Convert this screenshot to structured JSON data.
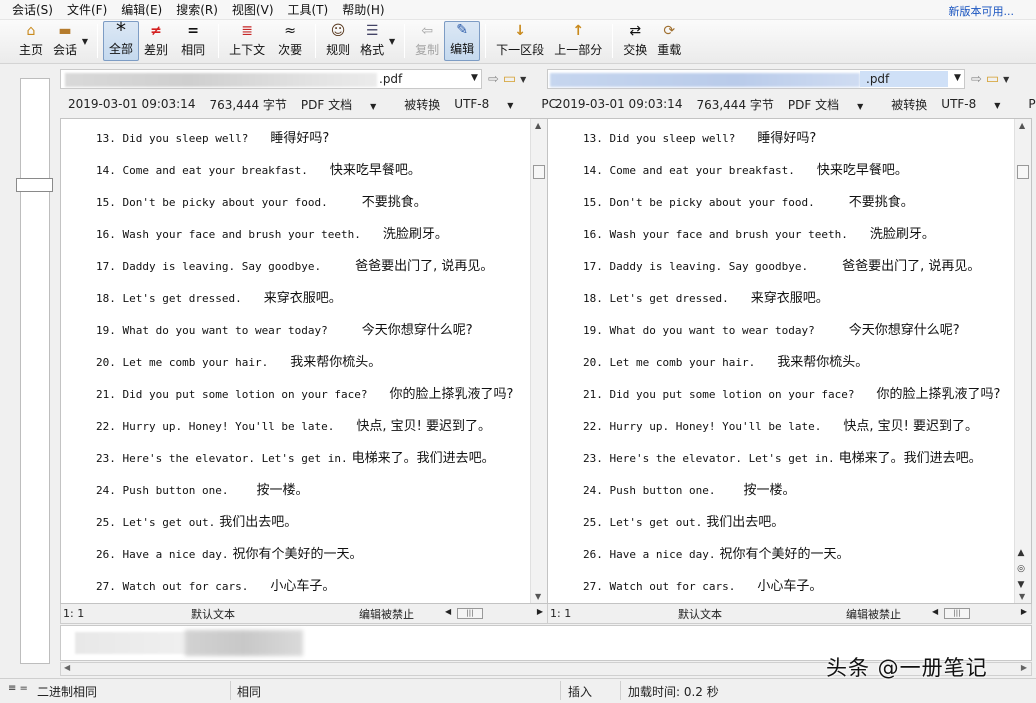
{
  "menu": [
    "会话(S)",
    "文件(F)",
    "编辑(E)",
    "搜索(R)",
    "视图(V)",
    "工具(T)",
    "帮助(H)"
  ],
  "promo": "新版本可用...",
  "toolbar": [
    {
      "label": "主页",
      "icon": "home-icon",
      "glyph": "⌂"
    },
    {
      "label": "会话",
      "icon": "briefcase-icon",
      "glyph": "▬"
    },
    {
      "label": "全部",
      "icon": "asterisk-icon",
      "glyph": "*"
    },
    {
      "label": "差别",
      "icon": "not-equal-icon",
      "glyph": "≠"
    },
    {
      "label": "相同",
      "icon": "equal-icon",
      "glyph": "="
    },
    {
      "label": "上下文",
      "icon": "context-icon",
      "glyph": "≣"
    },
    {
      "label": "次要",
      "icon": "approx-icon",
      "glyph": "≈"
    },
    {
      "label": "规则",
      "icon": "person-icon",
      "glyph": "☺"
    },
    {
      "label": "格式",
      "icon": "format-icon",
      "glyph": "☰"
    },
    {
      "label": "复制",
      "icon": "copy-arrow-icon",
      "glyph": "⇦"
    },
    {
      "label": "编辑",
      "icon": "pencil-icon",
      "glyph": "✎"
    },
    {
      "label": "下一区段",
      "icon": "arrow-down-icon",
      "glyph": "↓"
    },
    {
      "label": "上一部分",
      "icon": "arrow-up-icon",
      "glyph": "↑"
    },
    {
      "label": "交换",
      "icon": "swap-icon",
      "glyph": "⇄"
    },
    {
      "label": "重载",
      "icon": "reload-icon",
      "glyph": "⟳"
    }
  ],
  "left": {
    "path_suffix": ".pdf",
    "date": "2019-03-01 09:03:14",
    "size": "763,444 字节",
    "format": "PDF 文档",
    "state": "被转换",
    "encoding": "UTF-8",
    "lineend": "PC",
    "pos": "1: 1",
    "syntax": "默认文本",
    "editstate": "编辑被禁止"
  },
  "right": {
    "path_suffix": ".pdf",
    "date": "2019-03-01 09:03:14",
    "size": "763,444 字节",
    "format": "PDF 文档",
    "state": "被转换",
    "encoding": "UTF-8",
    "lineend": "PC",
    "pos": "1: 1",
    "syntax": "默认文本",
    "editstate": "编辑被禁止"
  },
  "lines": [
    {
      "en": "13. Did you sleep well?",
      "zh": "睡得好吗?",
      "gap": 3
    },
    {
      "en": "14. Come and eat your breakfast.",
      "zh": "快来吃早餐吧。",
      "gap": 3
    },
    {
      "en": "15. Don't be picky about your food.",
      "zh": "不要挑食。",
      "gap": 5
    },
    {
      "en": "16. Wash your face and brush your teeth.",
      "zh": "洗脸刷牙。",
      "gap": 3
    },
    {
      "en": "17. Daddy is leaving. Say goodbye.",
      "zh": "爸爸要出门了, 说再见。",
      "gap": 5
    },
    {
      "en": "18. Let's get dressed.",
      "zh": "来穿衣服吧。",
      "gap": 3
    },
    {
      "en": "19. What do you want to wear today?",
      "zh": "今天你想穿什么呢?",
      "gap": 5
    },
    {
      "en": "20. Let me comb your hair.",
      "zh": "我来帮你梳头。",
      "gap": 3
    },
    {
      "en": "21. Did you put some lotion on your face?",
      "zh": "你的脸上搽乳液了吗?",
      "gap": 3
    },
    {
      "en": "22. Hurry up. Honey! You'll be late.",
      "zh": "快点, 宝贝! 要迟到了。",
      "gap": 3
    },
    {
      "en": "23. Here's the elevator. Let's get in.",
      "zh": "电梯来了。我们进去吧。",
      "gap": 0
    },
    {
      "en": "24. Push button one.",
      "zh": "按一楼。",
      "gap": 4
    },
    {
      "en": "25. Let's get out.",
      "zh": "我们出去吧。",
      "gap": 0
    },
    {
      "en": "26. Have a nice day.",
      "zh": "祝你有个美好的一天。",
      "gap": 0
    },
    {
      "en": "27. Watch out for cars.",
      "zh": "小心车子。",
      "gap": 3
    }
  ],
  "status": {
    "binary": "二进制相同",
    "same": "相同",
    "insert": "插入",
    "loadtime": "加载时间: 0.2 秒"
  },
  "watermark": "头条 @一册笔记"
}
